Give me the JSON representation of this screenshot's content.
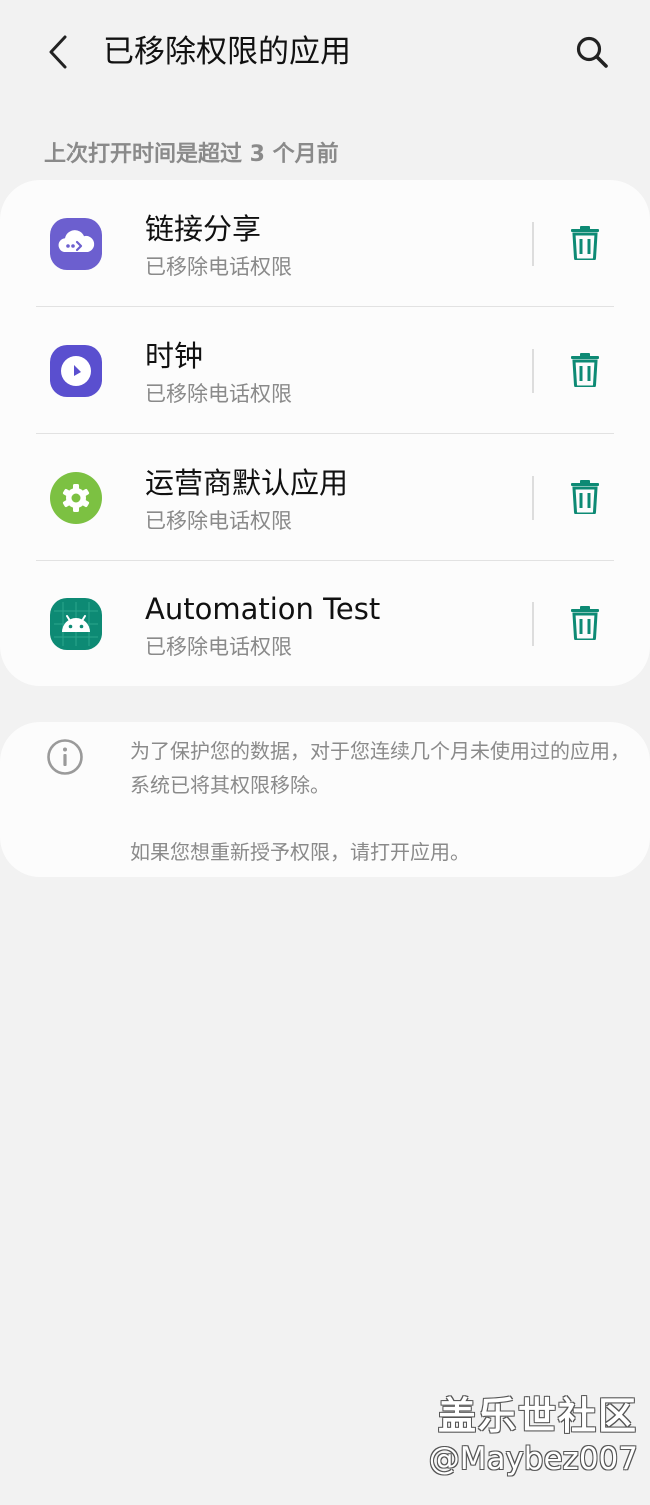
{
  "header": {
    "title": "已移除权限的应用"
  },
  "section": {
    "label": "上次打开时间是超过 3 个月前"
  },
  "apps": [
    {
      "name": "链接分享",
      "status": "已移除电话权限",
      "icon": "cloud-share-icon",
      "color": "#6c5fcf"
    },
    {
      "name": "时钟",
      "status": "已移除电话权限",
      "icon": "clock-icon",
      "color": "#5a4fcf"
    },
    {
      "name": "运营商默认应用",
      "status": "已移除电话权限",
      "icon": "gear-icon",
      "color": "#7cc142"
    },
    {
      "name": "Automation Test",
      "status": "已移除电话权限",
      "icon": "android-icon",
      "color": "#0d8a74"
    }
  ],
  "info": {
    "text": "为了保护您的数据，对于您连续几个月未使用过的应用，系统已将其权限移除。",
    "text2": "如果您想重新授予权限，请打开应用。"
  },
  "watermark": {
    "title": "盖乐世社区",
    "user": "@Maybez007"
  },
  "colors": {
    "accent": "#0d8a74",
    "background": "#f2f2f2",
    "card": "#fcfcfc"
  }
}
